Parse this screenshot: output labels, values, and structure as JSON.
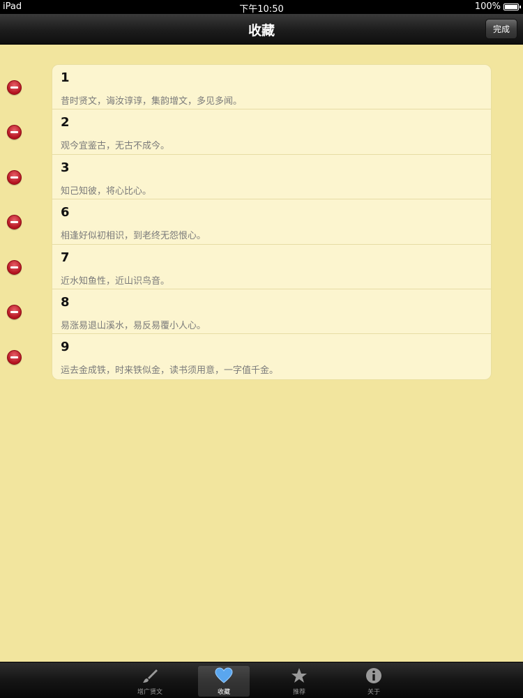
{
  "status_bar": {
    "device": "iPad",
    "time": "下午10:50",
    "battery": "100%"
  },
  "nav": {
    "title": "收藏",
    "done_label": "完成"
  },
  "favorites": [
    {
      "number": "1",
      "text": "昔时贤文，诲汝谆谆，集韵增文，多见多闻。"
    },
    {
      "number": "2",
      "text": "观今宜鉴古，无古不成今。"
    },
    {
      "number": "3",
      "text": "知己知彼，将心比心。"
    },
    {
      "number": "6",
      "text": "相逢好似初相识，到老终无怨恨心。"
    },
    {
      "number": "7",
      "text": "近水知鱼性，近山识鸟音。"
    },
    {
      "number": "8",
      "text": "易涨易退山溪水，易反易覆小人心。"
    },
    {
      "number": "9",
      "text": "运去金成铁，时来铁似金，读书须用意，一字值千金。"
    }
  ],
  "tabs": [
    {
      "label": "增广贤文",
      "icon": "brush-icon"
    },
    {
      "label": "收藏",
      "icon": "heart-icon",
      "selected": true
    },
    {
      "label": "推荐",
      "icon": "star-icon"
    },
    {
      "label": "关于",
      "icon": "info-icon"
    }
  ],
  "colors": {
    "background": "#f2e59e",
    "card": "#fcf5cf",
    "delete": "#c8202c",
    "selected_tab_icon": "#5aa6ee"
  }
}
